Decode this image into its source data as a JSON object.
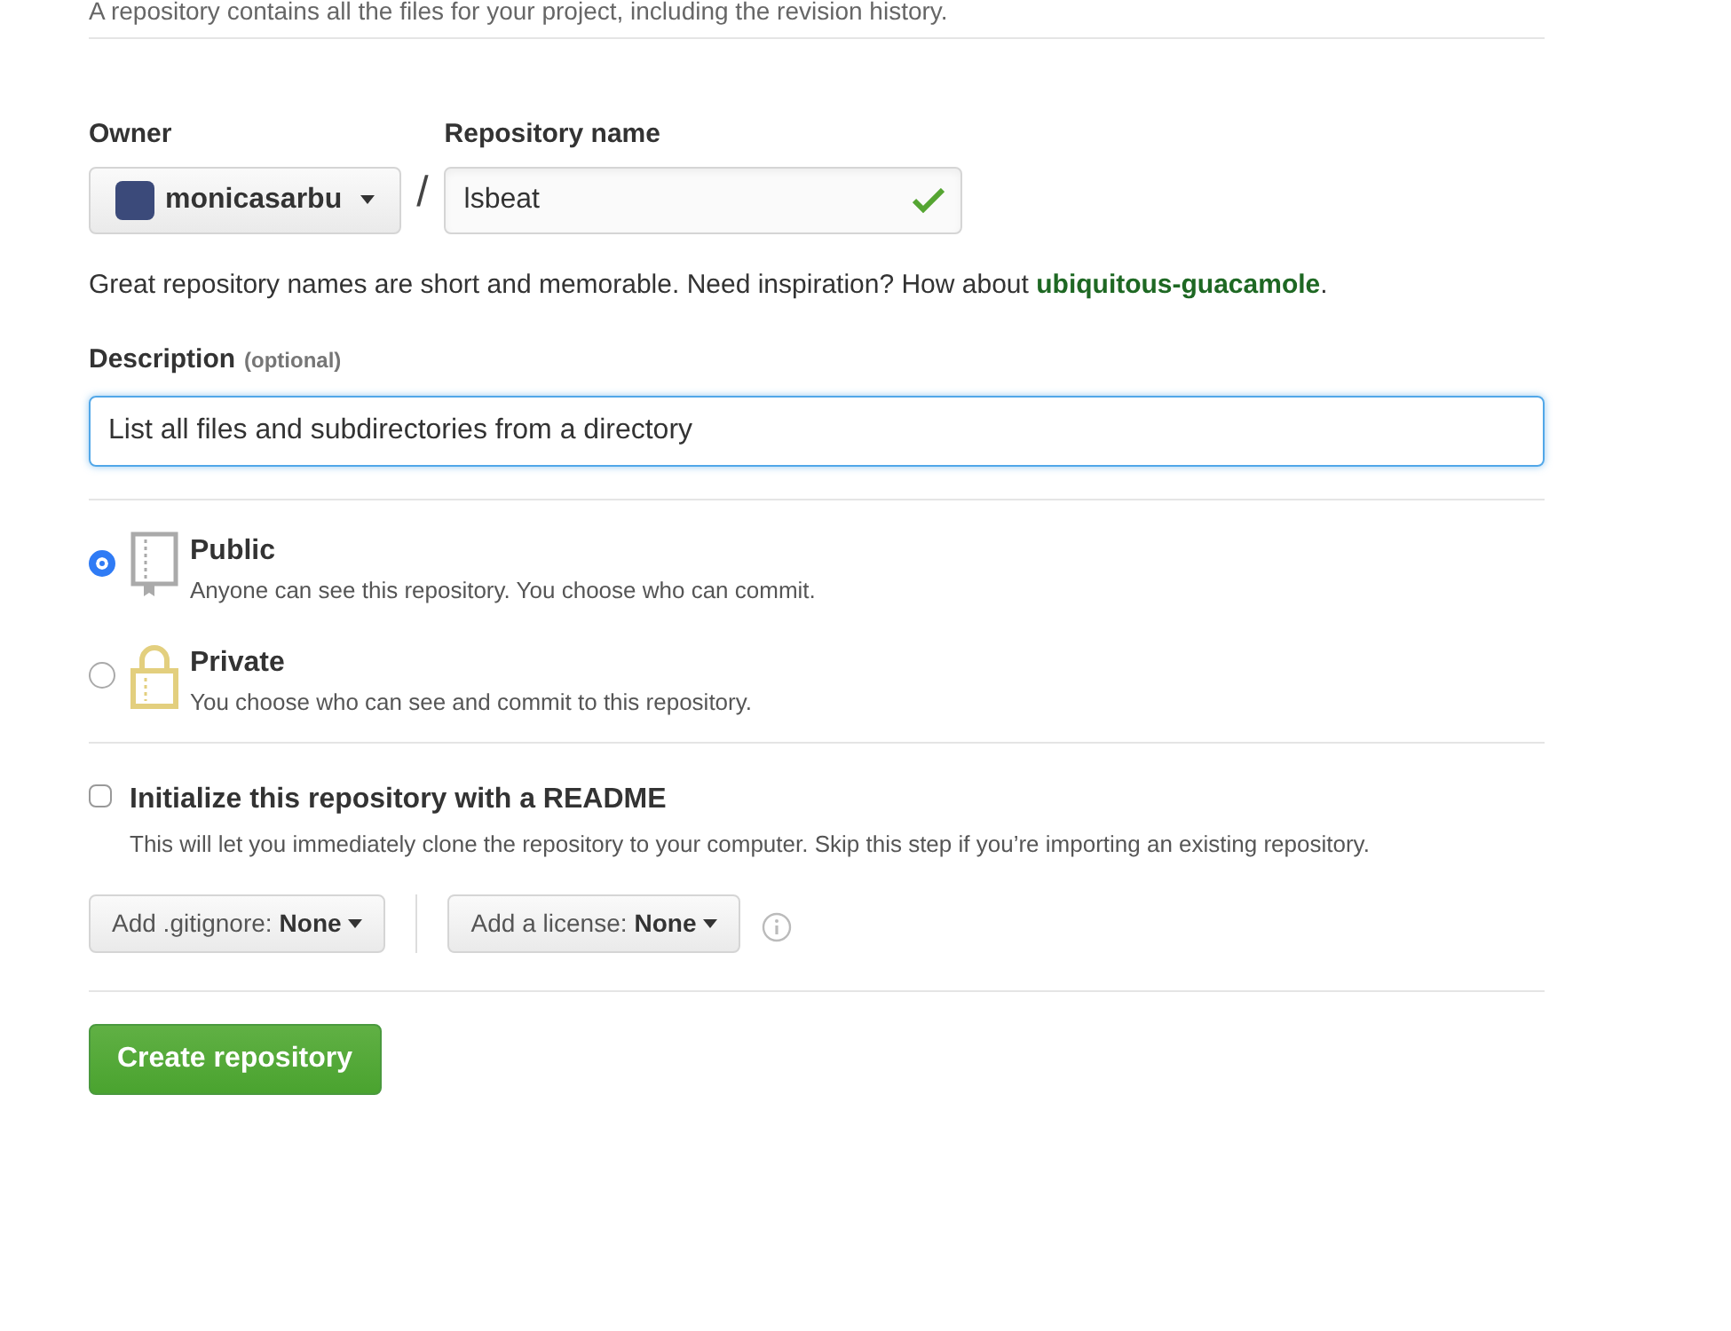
{
  "intro": "A repository contains all the files for your project, including the revision history.",
  "owner": {
    "label": "Owner",
    "value": "monicasarbu"
  },
  "separator": "/",
  "repo_name": {
    "label": "Repository name",
    "value": "lsbeat",
    "valid": true
  },
  "name_hint": {
    "text": "Great repository names are short and memorable. Need inspiration? How about",
    "suggestion": "ubiquitous-guacamole",
    "suffix": "."
  },
  "description": {
    "label": "Description",
    "optional": "(optional)",
    "value": "List all files and subdirectories from a directory",
    "focused": true
  },
  "visibility": [
    {
      "kind": "public",
      "title": "Public",
      "text": "Anyone can see this repository. You choose who can commit.",
      "selected": true
    },
    {
      "kind": "private",
      "title": "Private",
      "text": "You choose who can see and commit to this repository.",
      "selected": false
    }
  ],
  "readme": {
    "label": "Initialize this repository with a README",
    "text": "This will let you immediately clone the repository to your computer. Skip this step if you’re importing an existing repository.",
    "checked": false
  },
  "gitignore": {
    "label": "Add .gitignore:",
    "value": "None"
  },
  "license": {
    "label": "Add a license:",
    "value": "None"
  },
  "submit": "Create repository"
}
